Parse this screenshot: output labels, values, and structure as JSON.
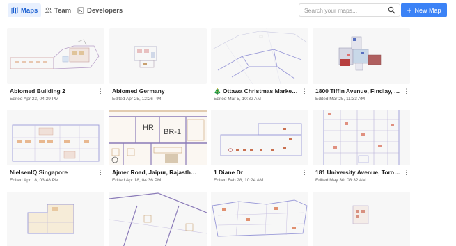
{
  "tabs": [
    {
      "label": "Maps",
      "icon": "map-icon",
      "active": true
    },
    {
      "label": "Team",
      "icon": "users-icon",
      "active": false
    },
    {
      "label": "Developers",
      "icon": "code-icon",
      "active": false
    }
  ],
  "search": {
    "placeholder": "Search your maps..."
  },
  "new_map_label": "New Map",
  "colors": {
    "accent": "#3b82f6",
    "active_tab_bg": "#e8f0fe",
    "active_tab_text": "#1a5fd1"
  },
  "maps": [
    {
      "title": "Abiomed Building 2",
      "edited": "Edited Apr 23, 04:39 PM"
    },
    {
      "title": "Abiomed Germany",
      "edited": "Edited Apr 25, 12:26 PM"
    },
    {
      "title": "🎄 Ottawa Christmas Market…",
      "edited": "Edited Mar 5, 10:32 AM"
    },
    {
      "title": "1800 Tiffin Avenue, Findlay, …",
      "edited": "Edited Mar 25, 11:33 AM"
    },
    {
      "title": "NielsenIQ Singapore",
      "edited": "Edited Apr 18, 03:48 PM"
    },
    {
      "title": "Ajmer Road, Jaipur, Rajasthan",
      "edited": "Edited Apr 18, 04:36 PM"
    },
    {
      "title": "1 Diane Dr",
      "edited": "Edited Feb 28, 10:24 AM"
    },
    {
      "title": "181 University Avenue, Toron…",
      "edited": "Edited May 30, 08:32 AM"
    },
    {
      "title": "",
      "edited": ""
    },
    {
      "title": "",
      "edited": ""
    },
    {
      "title": "",
      "edited": ""
    },
    {
      "title": "",
      "edited": ""
    }
  ],
  "thumb_labels": {
    "hr": "HR",
    "br": "BR-1"
  },
  "more_glyph": "⋮"
}
